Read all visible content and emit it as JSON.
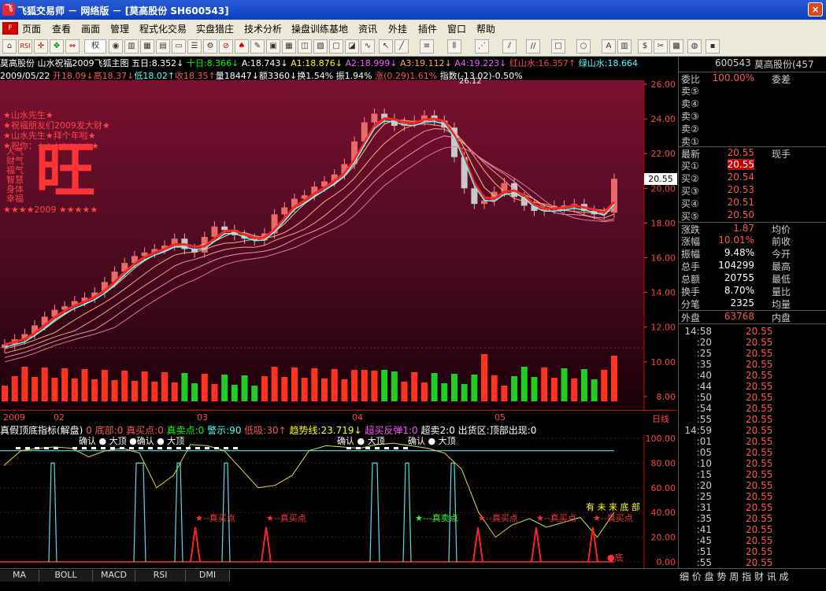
{
  "window": {
    "title": "飞狐交易师 － 网络版 － [莫高股份  SH600543]",
    "close": "×"
  },
  "menu": [
    "页面",
    "查看",
    "画面",
    "管理",
    "程式化交易",
    "实盘猎庄",
    "技术分析",
    "操盘训练基地",
    "资讯",
    "外挂",
    "插件",
    "窗口",
    "帮助"
  ],
  "toolbar": {
    "right_select": "权"
  },
  "main_header": [
    {
      "t": "莫高股份  山水祝福2009飞狐主图  五日:8.352↓",
      "c": "#ffffff"
    },
    {
      "t": " 十日:8.366↓",
      "c": "#00ff00"
    },
    {
      "t": " A:18.743↓",
      "c": "#ffffff"
    },
    {
      "t": " A1:18.876↓",
      "c": "#ffff00"
    },
    {
      "t": " A2:18.999↓",
      "c": "#ff55ff"
    },
    {
      "t": " A3:19.112↓",
      "c": "#ffaa55"
    },
    {
      "t": " A4:19.223↓",
      "c": "#ff55ff"
    },
    {
      "t": " 红山水:16.357↑",
      "c": "#ff4444"
    },
    {
      "t": " 绿山水:18.664",
      "c": "#55ffff"
    }
  ],
  "info_line": [
    {
      "t": "2009/05/22 ",
      "c": "#ffffff"
    },
    {
      "t": "开18.09↓",
      "c": "#ff5555"
    },
    {
      "t": "高18.37↓",
      "c": "#ff5555"
    },
    {
      "t": "低18.02↑",
      "c": "#55ffff"
    },
    {
      "t": "收18.35↑",
      "c": "#ff5555"
    },
    {
      "t": "量18447↓",
      "c": "#ffffff"
    },
    {
      "t": "额3360↓",
      "c": "#ffffff"
    },
    {
      "t": "换1.54%",
      "c": "#ffffff"
    },
    {
      "t": " 振1.94%",
      "c": "#ffffff"
    },
    {
      "t": " 涨(0.29)1.61%",
      "c": "#ff5555"
    },
    {
      "t": " 指数(-13.02)-0.50%",
      "c": "#ffffff"
    }
  ],
  "overlay_text": [
    "★山水先生★",
    "★祝福朋友们2009发大财★",
    "★山水先生★拜个年啦★",
    "★祝你：★★★★★★★★"
  ],
  "overlay_side": [
    "人气",
    "财气",
    "福气",
    "智慧",
    "身体",
    "幸福"
  ],
  "overlay_big": "旺",
  "overlay_bottom": "★★★★2009 ★★★★★",
  "price_axis": [
    "26.00",
    "24.00",
    "22.00",
    "20.00",
    "18.00",
    "16.00",
    "14.00",
    "12.00",
    "10.00",
    "8.00"
  ],
  "current_price_tag": "20.55",
  "peak_label": "26.12",
  "month_labels": [
    "2009",
    "02",
    "03",
    "04",
    "05"
  ],
  "timeframe": "日线",
  "ind_header": [
    {
      "t": "真假顶底指标(解盘)",
      "c": "#ffffff"
    },
    {
      "t": " 0 底部:0",
      "c": "#ff5555"
    },
    {
      "t": " 真买点:0",
      "c": "#ff5555"
    },
    {
      "t": " 真卖点:0",
      "c": "#00ff00"
    },
    {
      "t": " 警示:90",
      "c": "#55ffff"
    },
    {
      "t": " 低吸:30↑",
      "c": "#ff5555"
    },
    {
      "t": " 趋势线:23.719↓",
      "c": "#ffff00"
    },
    {
      "t": " 超买反弹1:0",
      "c": "#ff55ff"
    },
    {
      "t": " 超卖2:0",
      "c": "#ffffff"
    },
    {
      "t": " 出货区:顶部出现:0",
      "c": "#ffffff"
    }
  ],
  "ind_axis": [
    "100.00",
    "80.00",
    "60.00",
    "40.00",
    "20.00",
    "0.00"
  ],
  "ind_annotations": {
    "confirm1": "确认 ● 大顶 ●确认 ● 大顶",
    "confirm2": "确认 ● 大顶",
    "confirm3": "确认 ● 大顶",
    "buy": "★--真买点",
    "sell": "★---真卖点",
    "top_chars": "有 未 来 底 部",
    "bottom": "●底"
  },
  "quote": {
    "code": "600543",
    "name": "莫高股份(457",
    "weibi_l": "委比",
    "weibi_v": "100.00%",
    "weicha_l": "委差",
    "sells": [
      "卖⑤",
      "卖④",
      "卖③",
      "卖②",
      "卖①"
    ],
    "latest_l": "最新",
    "latest_v": "20.55",
    "xianshou_l": "现手",
    "buys": [
      {
        "l": "买①",
        "v": "20.55"
      },
      {
        "l": "买②",
        "v": "20.54"
      },
      {
        "l": "买③",
        "v": "20.53"
      },
      {
        "l": "买④",
        "v": "20.51"
      },
      {
        "l": "买⑤",
        "v": "20.50"
      }
    ],
    "stats": [
      {
        "l": "涨跌",
        "v": "1.87",
        "l2": "均价"
      },
      {
        "l": "涨幅",
        "v": "10.01%",
        "l2": "前收"
      },
      {
        "l": "振幅",
        "v": "9.48%",
        "l2": "今开"
      },
      {
        "l": "总手",
        "v": "104299",
        "l2": "最高"
      },
      {
        "l": "总额",
        "v": "20755",
        "l2": "最低"
      },
      {
        "l": "换手",
        "v": "8.70%",
        "l2": "量比"
      },
      {
        "l": "分笔",
        "v": "2325",
        "l2": "均量"
      }
    ],
    "outer_l": "外盘",
    "outer_v": "63768",
    "inner_l": "内盘"
  },
  "ticks": [
    {
      "t": "14:58",
      "p": "20.55"
    },
    {
      "t": ":20",
      "p": "20.55"
    },
    {
      "t": ":25",
      "p": "20.55"
    },
    {
      "t": ":35",
      "p": "20.55"
    },
    {
      "t": ":40",
      "p": "20.55"
    },
    {
      "t": ":44",
      "p": "20.55"
    },
    {
      "t": ":50",
      "p": "20.55"
    },
    {
      "t": ":54",
      "p": "20.55"
    },
    {
      "t": ":55",
      "p": "20.55"
    },
    {
      "t": "14:59",
      "p": "20.55"
    },
    {
      "t": ":01",
      "p": "20.55"
    },
    {
      "t": ":05",
      "p": "20.55"
    },
    {
      "t": ":10",
      "p": "20.55"
    },
    {
      "t": ":15",
      "p": "20.55"
    },
    {
      "t": ":20",
      "p": "20.55"
    },
    {
      "t": ":25",
      "p": "20.55"
    },
    {
      "t": ":31",
      "p": "20.55"
    },
    {
      "t": ":35",
      "p": "20.55"
    },
    {
      "t": ":41",
      "p": "20.55"
    },
    {
      "t": ":45",
      "p": "20.55"
    },
    {
      "t": ":51",
      "p": "20.55"
    },
    {
      "t": ":55",
      "p": "20.55"
    }
  ],
  "bottom_tabs": [
    "MA",
    "BOLL",
    "MACD",
    "RSI",
    "DMI"
  ],
  "right_tabs": "细 价 盘 势 周 指 财 讯 成",
  "colors": {
    "up": "#ff4444",
    "down": "#00ff00",
    "chart_bg": "#6e0e2e",
    "accent": "#ffff00"
  }
}
